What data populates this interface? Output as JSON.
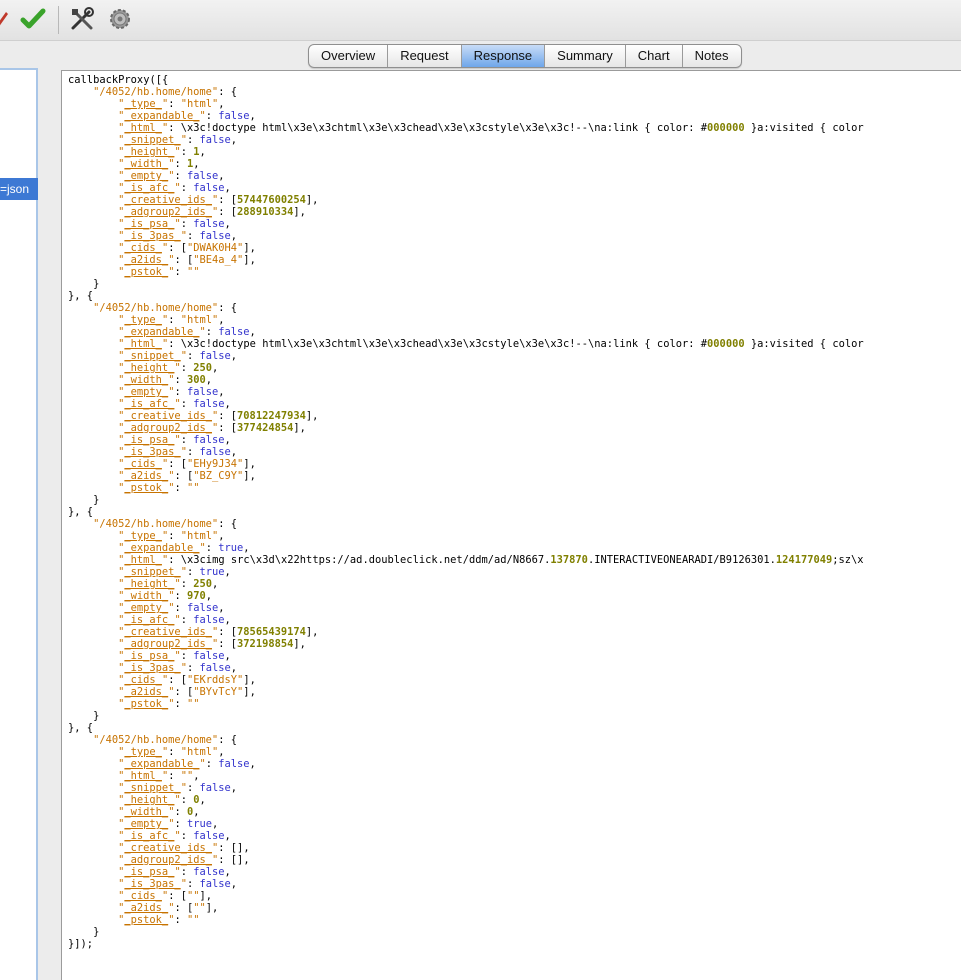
{
  "toolbar": {
    "buttons": [
      {
        "name": "edit-icon"
      },
      {
        "name": "checkmark-icon"
      },
      {
        "name": "tools-icon"
      },
      {
        "name": "gear-icon"
      }
    ]
  },
  "left_panel": {
    "selected_item_text": "=json"
  },
  "tabs": [
    {
      "label": "Overview",
      "active": false
    },
    {
      "label": "Request",
      "active": false
    },
    {
      "label": "Response",
      "active": true
    },
    {
      "label": "Summary",
      "active": false
    },
    {
      "label": "Chart",
      "active": false
    },
    {
      "label": "Notes",
      "active": false
    }
  ],
  "colors": {
    "string": "#c77300",
    "boolean": "#3333cc",
    "number": "#808000",
    "tab_active": "#6fa6ea",
    "selection": "#3d79d4"
  },
  "response": {
    "lines": [
      "callbackProxy([{",
      "    \"/4052/hb.home/home\": {",
      "        \"_type_\": \"html\",",
      "        \"_expandable_\": false,",
      "        \"_html_\": \"\\x3c!doctype html\\x3e\\x3chtml\\x3e\\x3chead\\x3e\\x3cstyle\\x3e\\x3c!--\\na:link { color: #000000 }a:visited { color",
      "        \"_snippet_\": false,",
      "        \"_height_\": 1,",
      "        \"_width_\": 1,",
      "        \"_empty_\": false,",
      "        \"_is_afc_\": false,",
      "        \"_creative_ids_\": [57447600254],",
      "        \"_adgroup2_ids_\": [288910334],",
      "        \"_is_psa_\": false,",
      "        \"_is_3pas_\": false,",
      "        \"_cids_\": [\"DWAK0H4\"],",
      "        \"_a2ids_\": [\"BE4a_4\"],",
      "        \"_pstok_\": \"\"",
      "    }",
      "}, {",
      "    \"/4052/hb.home/home\": {",
      "        \"_type_\": \"html\",",
      "        \"_expandable_\": false,",
      "        \"_html_\": \"\\x3c!doctype html\\x3e\\x3chtml\\x3e\\x3chead\\x3e\\x3cstyle\\x3e\\x3c!--\\na:link { color: #000000 }a:visited { color",
      "        \"_snippet_\": false,",
      "        \"_height_\": 250,",
      "        \"_width_\": 300,",
      "        \"_empty_\": false,",
      "        \"_is_afc_\": false,",
      "        \"_creative_ids_\": [70812247934],",
      "        \"_adgroup2_ids_\": [377424854],",
      "        \"_is_psa_\": false,",
      "        \"_is_3pas_\": false,",
      "        \"_cids_\": [\"EHy9J34\"],",
      "        \"_a2ids_\": [\"BZ_C9Y\"],",
      "        \"_pstok_\": \"\"",
      "    }",
      "}, {",
      "    \"/4052/hb.home/home\": {",
      "        \"_type_\": \"html\",",
      "        \"_expandable_\": true,",
      "        \"_html_\": \"\\x3cimg src\\x3d\\x22https://ad.doubleclick.net/ddm/ad/N8667.137870.INTERACTIVEONEARADI/B9126301.124177049;sz\\x",
      "        \"_snippet_\": true,",
      "        \"_height_\": 250,",
      "        \"_width_\": 970,",
      "        \"_empty_\": false,",
      "        \"_is_afc_\": false,",
      "        \"_creative_ids_\": [78565439174],",
      "        \"_adgroup2_ids_\": [372198854],",
      "        \"_is_psa_\": false,",
      "        \"_is_3pas_\": false,",
      "        \"_cids_\": [\"EKrddsY\"],",
      "        \"_a2ids_\": [\"BYvTcY\"],",
      "        \"_pstok_\": \"\"",
      "    }",
      "}, {",
      "    \"/4052/hb.home/home\": {",
      "        \"_type_\": \"html\",",
      "        \"_expandable_\": false,",
      "        \"_html_\": \"\",",
      "        \"_snippet_\": false,",
      "        \"_height_\": 0,",
      "        \"_width_\": 0,",
      "        \"_empty_\": true,",
      "        \"_is_afc_\": false,",
      "        \"_creative_ids_\": [],",
      "        \"_adgroup2_ids_\": [],",
      "        \"_is_psa_\": false,",
      "        \"_is_3pas_\": false,",
      "        \"_cids_\": [\"\"],",
      "        \"_a2ids_\": [\"\"],",
      "        \"_pstok_\": \"\"",
      "    }",
      "}]);"
    ]
  }
}
